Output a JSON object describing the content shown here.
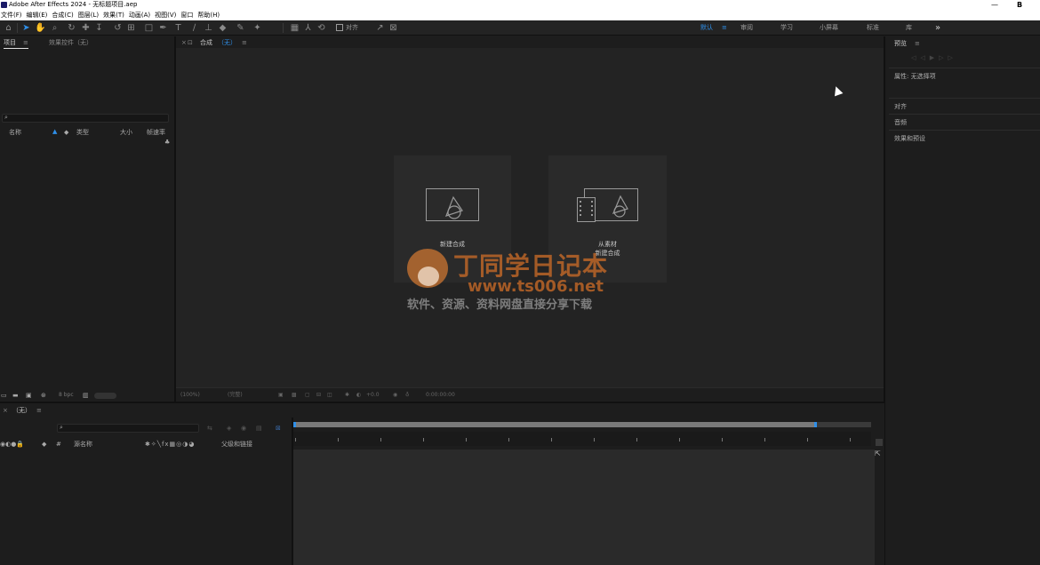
{
  "titlebar": {
    "title": "Adobe After Effects 2024 - 无标题项目.aep",
    "close_glyph": "B",
    "minimize_glyph": "—"
  },
  "menubar": {
    "items": [
      "文件(F)",
      "编辑(E)",
      "合成(C)",
      "图层(L)",
      "效果(T)",
      "动画(A)",
      "视图(V)",
      "窗口",
      "帮助(H)"
    ]
  },
  "toolbar": {
    "align_label": "对齐",
    "workspaces": [
      "默认",
      "审阅",
      "学习",
      "小屏幕",
      "标准",
      "库"
    ],
    "workspace_menu_glyph": "≡",
    "overflow_glyph": "»"
  },
  "project_panel": {
    "tabs": [
      "项目",
      "效果控件（无）"
    ],
    "menu_glyph": "≡",
    "columns": [
      "名称",
      "类型",
      "大小",
      "帧速率"
    ],
    "bpc_label": "8 bpc"
  },
  "comp_panel": {
    "tab_label": "合成",
    "tab_value": "（无）",
    "menu_glyph": "≡",
    "card_new_comp": "新建合成",
    "card_from_footage_line1": "从素材",
    "card_from_footage_line2": "新建合成",
    "zoom": "(100%)",
    "resolution": "(完整)",
    "exposure": "+0.0",
    "timecode": "0:00:00:00"
  },
  "right_panel": {
    "preview_tab": "预览",
    "menu_glyph": "≡",
    "properties": "属性: 无选择项",
    "sections": [
      "对齐",
      "音频",
      "效果和预设"
    ]
  },
  "timeline": {
    "tab_label": "（无）",
    "menu_glyph": "≡",
    "col_source": "源名称",
    "col_parent": "父级和链接",
    "col_hash": "#"
  },
  "watermark": {
    "title": "丁同学日记本",
    "url": "www.ts006.net",
    "subtitle": "软件、资源、资料网盘直接分享下载"
  },
  "colors": {
    "accent": "#2f8fe8",
    "panel": "#1d1d1d",
    "watermark": "#d67028"
  }
}
